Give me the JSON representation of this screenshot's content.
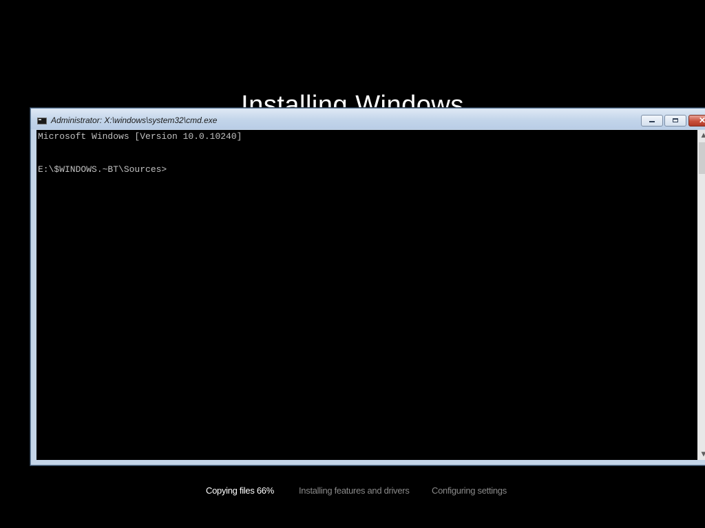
{
  "setup": {
    "title": "Installing Windows",
    "steps": [
      {
        "label": "Copying files 66%",
        "active": true
      },
      {
        "label": "Installing features and drivers",
        "active": false
      },
      {
        "label": "Configuring settings",
        "active": false
      }
    ]
  },
  "cmd_window": {
    "title": "Administrator: X:\\windows\\system32\\cmd.exe",
    "icon": "console-icon",
    "buttons": {
      "minimize_icon": "minimize-icon",
      "maximize_icon": "maximize-icon",
      "close_label": "✕"
    },
    "console_lines": [
      "Microsoft Windows [Version 10.0.10240]",
      "E:\\$WINDOWS.~BT\\Sources>"
    ],
    "scroll_arrows": {
      "up": "▲",
      "down": "▼"
    }
  },
  "colors": {
    "background": "#000000",
    "console_text": "#c0c0c0",
    "window_frame": "#c4d5e8",
    "close_button": "#c8503c",
    "step_active": "#ffffff",
    "step_inactive": "#8a8a8a"
  }
}
